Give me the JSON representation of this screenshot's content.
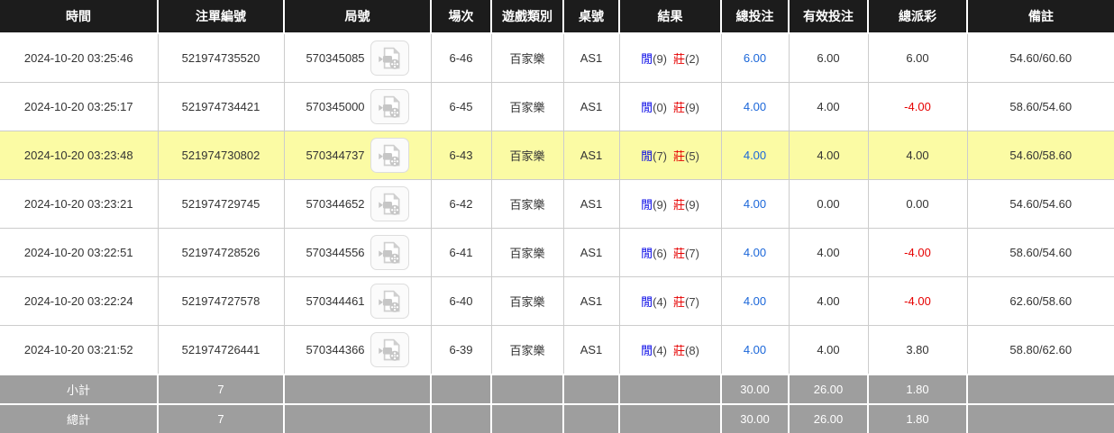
{
  "table": {
    "columns": [
      {
        "key": "time",
        "label": "時間"
      },
      {
        "key": "bet_id",
        "label": "注單編號"
      },
      {
        "key": "round",
        "label": "局號"
      },
      {
        "key": "session",
        "label": "場次"
      },
      {
        "key": "game_type",
        "label": "遊戲類別"
      },
      {
        "key": "table_no",
        "label": "桌號"
      },
      {
        "key": "result",
        "label": "結果"
      },
      {
        "key": "total_bet",
        "label": "總投注"
      },
      {
        "key": "valid_bet",
        "label": "有效投注"
      },
      {
        "key": "total_payout",
        "label": "總派彩"
      },
      {
        "key": "remark",
        "label": "備註"
      }
    ],
    "result_labels": {
      "player": "閒",
      "banker": "莊"
    },
    "icons": {
      "round_video": "video-file-icon"
    },
    "rows": [
      {
        "time": "2024-10-20 03:25:46",
        "bet_id": "521974735520",
        "round": "570345085",
        "session": "6-46",
        "game_type": "百家樂",
        "table_no": "AS1",
        "player": "(9)",
        "banker": "(2)",
        "total_bet": "6.00",
        "valid_bet": "6.00",
        "total_payout": "6.00",
        "remark": "54.60/60.60",
        "highlighted": false
      },
      {
        "time": "2024-10-20 03:25:17",
        "bet_id": "521974734421",
        "round": "570345000",
        "session": "6-45",
        "game_type": "百家樂",
        "table_no": "AS1",
        "player": "(0)",
        "banker": "(9)",
        "total_bet": "4.00",
        "valid_bet": "4.00",
        "total_payout": "-4.00",
        "remark": "58.60/54.60",
        "highlighted": false
      },
      {
        "time": "2024-10-20 03:23:48",
        "bet_id": "521974730802",
        "round": "570344737",
        "session": "6-43",
        "game_type": "百家樂",
        "table_no": "AS1",
        "player": "(7)",
        "banker": "(5)",
        "total_bet": "4.00",
        "valid_bet": "4.00",
        "total_payout": "4.00",
        "remark": "54.60/58.60",
        "highlighted": true
      },
      {
        "time": "2024-10-20 03:23:21",
        "bet_id": "521974729745",
        "round": "570344652",
        "session": "6-42",
        "game_type": "百家樂",
        "table_no": "AS1",
        "player": "(9)",
        "banker": "(9)",
        "total_bet": "4.00",
        "valid_bet": "0.00",
        "total_payout": "0.00",
        "remark": "54.60/54.60",
        "highlighted": false
      },
      {
        "time": "2024-10-20 03:22:51",
        "bet_id": "521974728526",
        "round": "570344556",
        "session": "6-41",
        "game_type": "百家樂",
        "table_no": "AS1",
        "player": "(6)",
        "banker": "(7)",
        "total_bet": "4.00",
        "valid_bet": "4.00",
        "total_payout": "-4.00",
        "remark": "58.60/54.60",
        "highlighted": false
      },
      {
        "time": "2024-10-20 03:22:24",
        "bet_id": "521974727578",
        "round": "570344461",
        "session": "6-40",
        "game_type": "百家樂",
        "table_no": "AS1",
        "player": "(4)",
        "banker": "(7)",
        "total_bet": "4.00",
        "valid_bet": "4.00",
        "total_payout": "-4.00",
        "remark": "62.60/58.60",
        "highlighted": false
      },
      {
        "time": "2024-10-20 03:21:52",
        "bet_id": "521974726441",
        "round": "570344366",
        "session": "6-39",
        "game_type": "百家樂",
        "table_no": "AS1",
        "player": "(4)",
        "banker": "(8)",
        "total_bet": "4.00",
        "valid_bet": "4.00",
        "total_payout": "3.80",
        "remark": "58.80/62.60",
        "highlighted": false
      }
    ],
    "footer": {
      "subtotal": {
        "label": "小計",
        "count": "7",
        "total_bet": "30.00",
        "valid_bet": "26.00",
        "total_payout": "1.80"
      },
      "total": {
        "label": "總計",
        "count": "7",
        "total_bet": "30.00",
        "valid_bet": "26.00",
        "total_payout": "1.80"
      }
    },
    "colors": {
      "header_bg": "#1c1c1c",
      "header_text": "#ffffff",
      "row_highlight": "#fbfba4",
      "player_blue": "#0000e6",
      "banker_red": "#e60000",
      "bet_amount_blue": "#1a66d9",
      "negative_red": "#e60000",
      "footer_bg": "#9e9e9e",
      "grid_line": "#cccccc"
    }
  }
}
